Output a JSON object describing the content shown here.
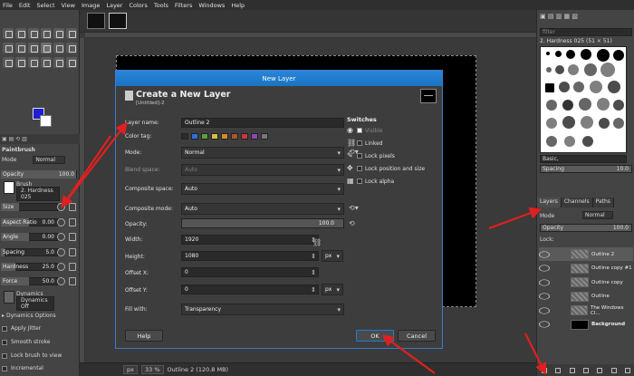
{
  "menubar": [
    "File",
    "Edit",
    "Select",
    "View",
    "Image",
    "Layer",
    "Colors",
    "Tools",
    "Filters",
    "Windows",
    "Help"
  ],
  "tool_options": {
    "title": "Paintbrush",
    "mode_label": "Mode",
    "mode_value": "Normal",
    "opacity_label": "Opacity",
    "opacity_value": "100.0",
    "brush_label": "Brush",
    "brush_value": "2. Hardness 025",
    "size_label": "Size",
    "aspect_label": "Aspect Ratio",
    "aspect_value": "0.00",
    "angle_label": "Angle",
    "angle_value": "0.00",
    "spacing_label": "Spacing",
    "spacing_value": "5.0",
    "hardness_label": "Hardness",
    "hardness_value": "25.0",
    "force_label": "Force",
    "force_value": "50.0",
    "dynamics_label": "Dynamics",
    "dynamics_value": "Dynamics Off",
    "dynamics_options": "Dynamics Options",
    "apply_jitter": "Apply Jitter",
    "smooth_stroke": "Smooth stroke",
    "lock_brush": "Lock brush to view",
    "incremental": "Incremental"
  },
  "statusbar": {
    "unit": "px",
    "zoom": "33 %",
    "info": "Outline 2 (120.8 MB)"
  },
  "dock": {
    "filter_placeholder": "filter",
    "brush_title": "2. Hardness 025 (51 × 51)",
    "brush_preset": "Basic,",
    "spacing_label": "Spacing",
    "spacing_value": "10.0",
    "tabs": [
      "Layers",
      "Channels",
      "Paths"
    ],
    "mode_label": "Mode",
    "mode_value": "Normal",
    "opacity_label": "Opacity",
    "opacity_value": "100.0",
    "lock_label": "Lock:",
    "layers": [
      {
        "name": "Outline 2",
        "selected": true,
        "thumb": "checker"
      },
      {
        "name": "Outline copy #1",
        "selected": false,
        "thumb": "checker"
      },
      {
        "name": "Outline copy",
        "selected": false,
        "thumb": "checker"
      },
      {
        "name": "Outline",
        "selected": false,
        "thumb": "checker"
      },
      {
        "name": "The Windows Cl...",
        "selected": false,
        "thumb": "checker"
      },
      {
        "name": "Background",
        "selected": false,
        "thumb": "black"
      }
    ]
  },
  "dialog": {
    "window_title": "New Layer",
    "header_title": "Create a New Layer",
    "header_subtitle": "[Untitled]-2",
    "layer_name_label": "Layer name:",
    "layer_name_value": "Outline 2",
    "color_tag_label": "Color tag:",
    "color_tags": [
      "#2d6fd6",
      "#5aa03c",
      "#d2c23a",
      "#d98a2b",
      "#a5572c",
      "#c43b3b",
      "#8b47b8",
      "#777777"
    ],
    "mode_label": "Mode:",
    "mode_value": "Normal",
    "blend_label": "Blend space:",
    "blend_value": "Auto",
    "composite_space_label": "Composite space:",
    "composite_space_value": "Auto",
    "composite_mode_label": "Composite mode:",
    "composite_mode_value": "Auto",
    "opacity_label": "Opacity:",
    "opacity_value": "100.0",
    "width_label": "Width:",
    "width_value": "1920",
    "height_label": "Height:",
    "height_value": "1080",
    "unit_value": "px",
    "offset_x_label": "Offset X:",
    "offset_x_value": "0",
    "offset_y_label": "Offset Y:",
    "offset_y_value": "0",
    "fill_label": "Fill with:",
    "fill_value": "Transparency",
    "switches_title": "Switches",
    "visible_label": "Visible",
    "linked_label": "Linked",
    "lock_pixels_label": "Lock pixels",
    "lock_position_label": "Lock position and size",
    "lock_alpha_label": "Lock alpha",
    "help_button": "Help",
    "ok_button": "OK",
    "cancel_button": "Cancel"
  },
  "colors": {
    "accent": "#1e7ad6",
    "annotation": "#e02020",
    "foreground": "#1f1fd6",
    "background": "#ffffff"
  }
}
